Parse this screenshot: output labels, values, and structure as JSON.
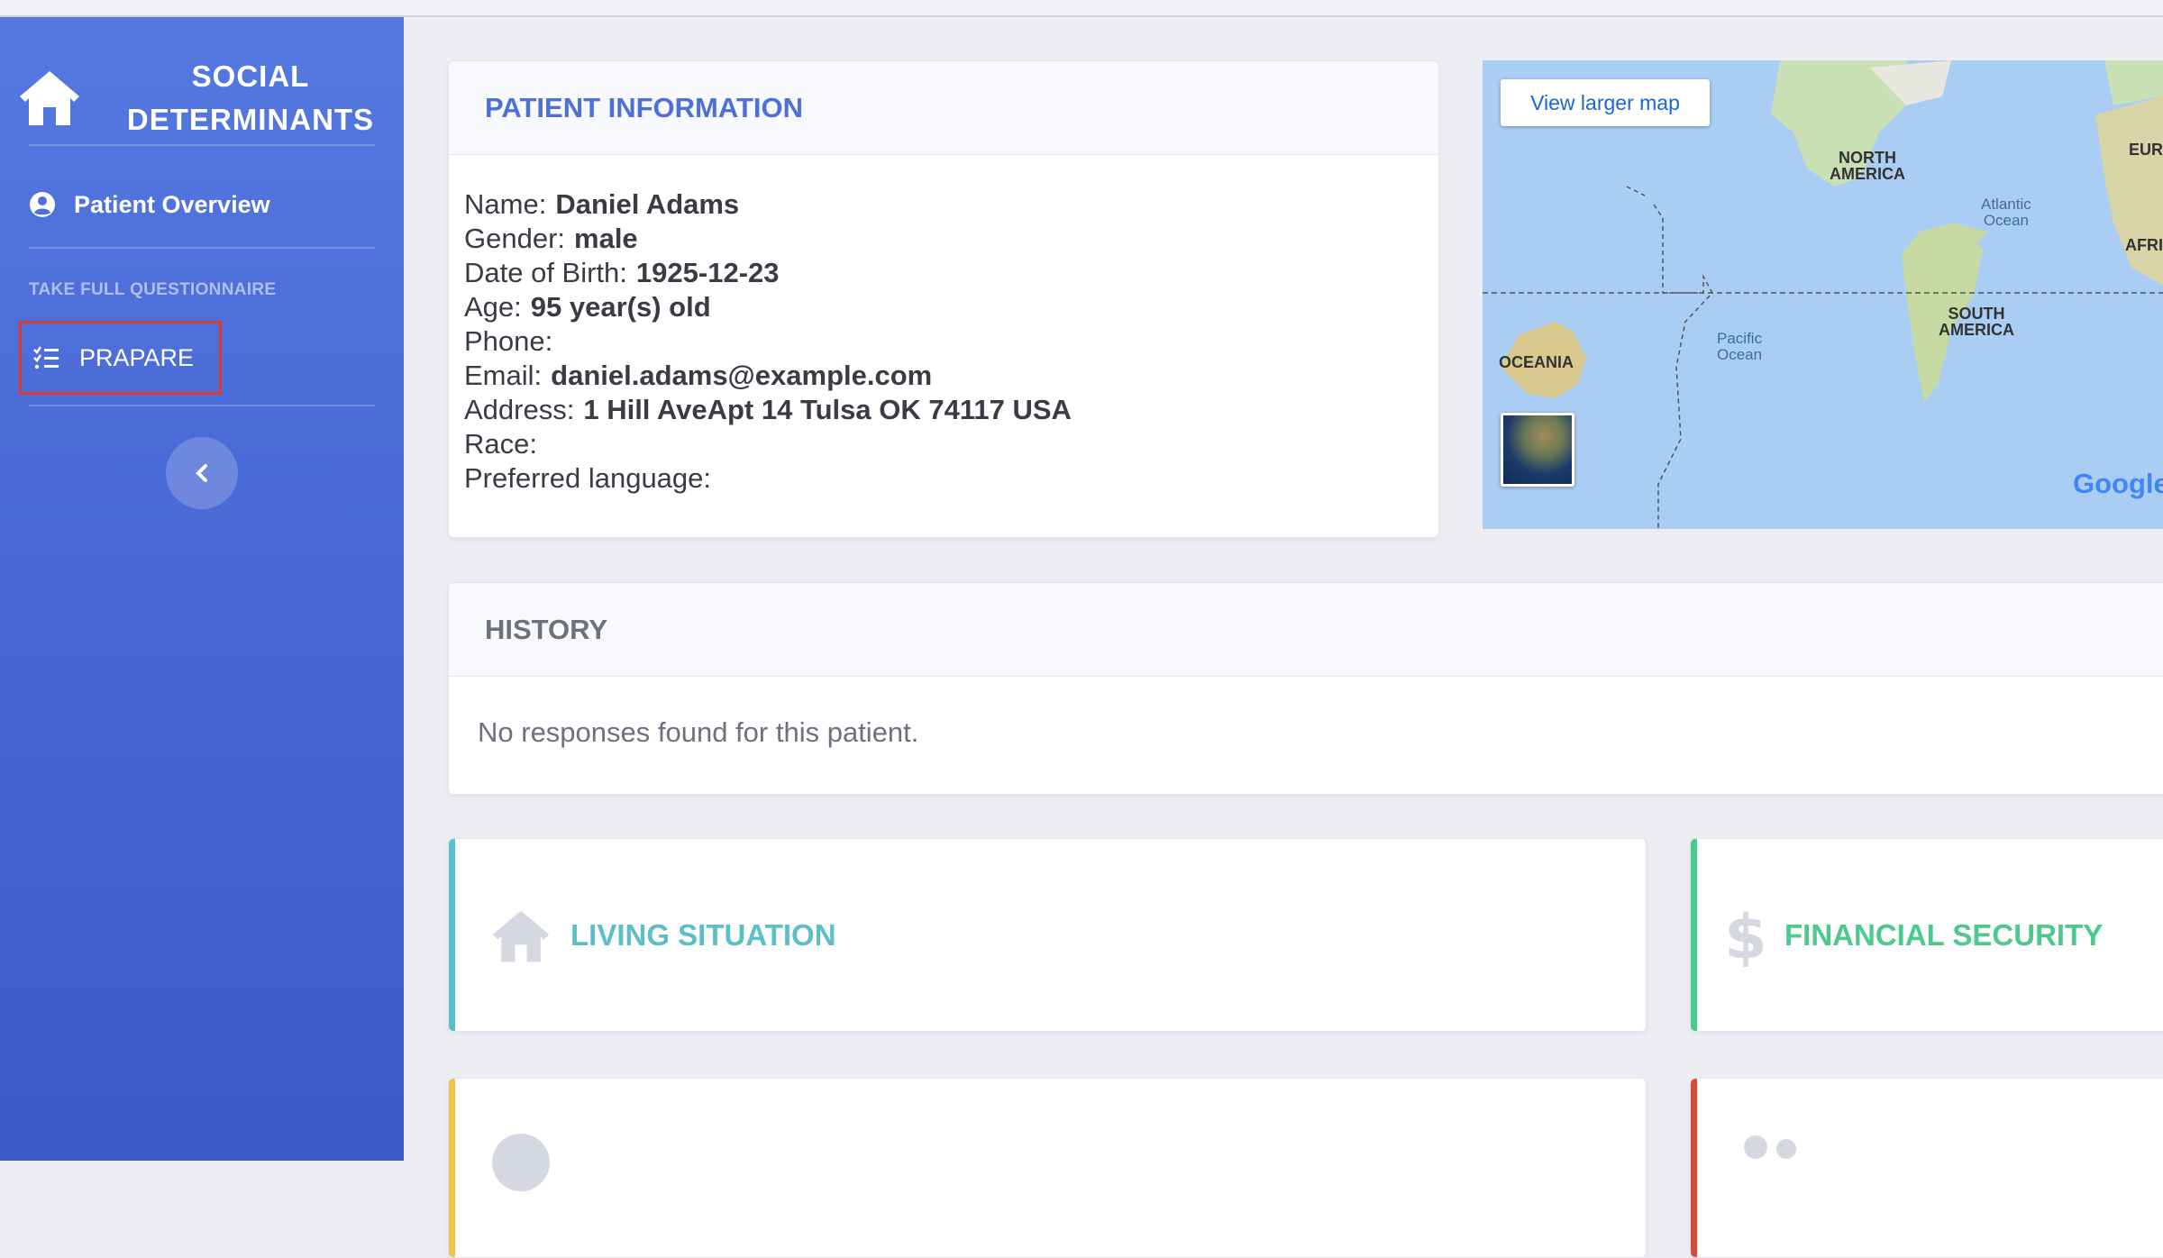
{
  "sidebar": {
    "brand_line1": "SOCIAL",
    "brand_line2": "DETERMINANTS",
    "overview_label": "Patient Overview",
    "section_heading": "TAKE FULL QUESTIONNAIRE",
    "prapare_label": "PRAPARE"
  },
  "patient": {
    "header": "PATIENT INFORMATION",
    "fields": [
      {
        "label": "Name:",
        "value": "Daniel Adams"
      },
      {
        "label": "Gender:",
        "value": "male"
      },
      {
        "label": "Date of Birth:",
        "value": "1925-12-23"
      },
      {
        "label": "Age:",
        "value": "95 year(s) old"
      },
      {
        "label": "Phone:",
        "value": ""
      },
      {
        "label": "Email:",
        "value": "daniel.adams@example.com"
      },
      {
        "label": "Address:",
        "value": "1 Hill AveApt 14 Tulsa OK 74117 USA"
      },
      {
        "label": "Race:",
        "value": ""
      },
      {
        "label": "Preferred language:",
        "value": ""
      }
    ]
  },
  "map": {
    "button": "View larger map",
    "labels": {
      "north_america_1": "NORTH",
      "north_america_2": "AMERICA",
      "south_america_1": "SOUTH",
      "south_america_2": "AMERICA",
      "oceania": "OCEANIA",
      "europe": "EUR",
      "africa": "AFRI",
      "atlantic_1": "Atlantic",
      "atlantic_2": "Ocean",
      "pacific_1": "Pacific",
      "pacific_2": "Ocean"
    },
    "logo": "Google"
  },
  "history": {
    "header": "HISTORY",
    "empty": "No responses found for this patient."
  },
  "domains": {
    "living": "LIVING SITUATION",
    "financial": "FINANCIAL SECURITY"
  },
  "colors": {
    "sidebar_top": "#5478e0",
    "sidebar_bottom": "#3e5bc9",
    "primary_text": "#4f6fd8",
    "highlight_border": "#d93b32",
    "living_accent": "#5bbfc8",
    "financial_accent": "#4cc98c",
    "social_accent": "#f1c24a",
    "safety_accent": "#d64a3a"
  }
}
